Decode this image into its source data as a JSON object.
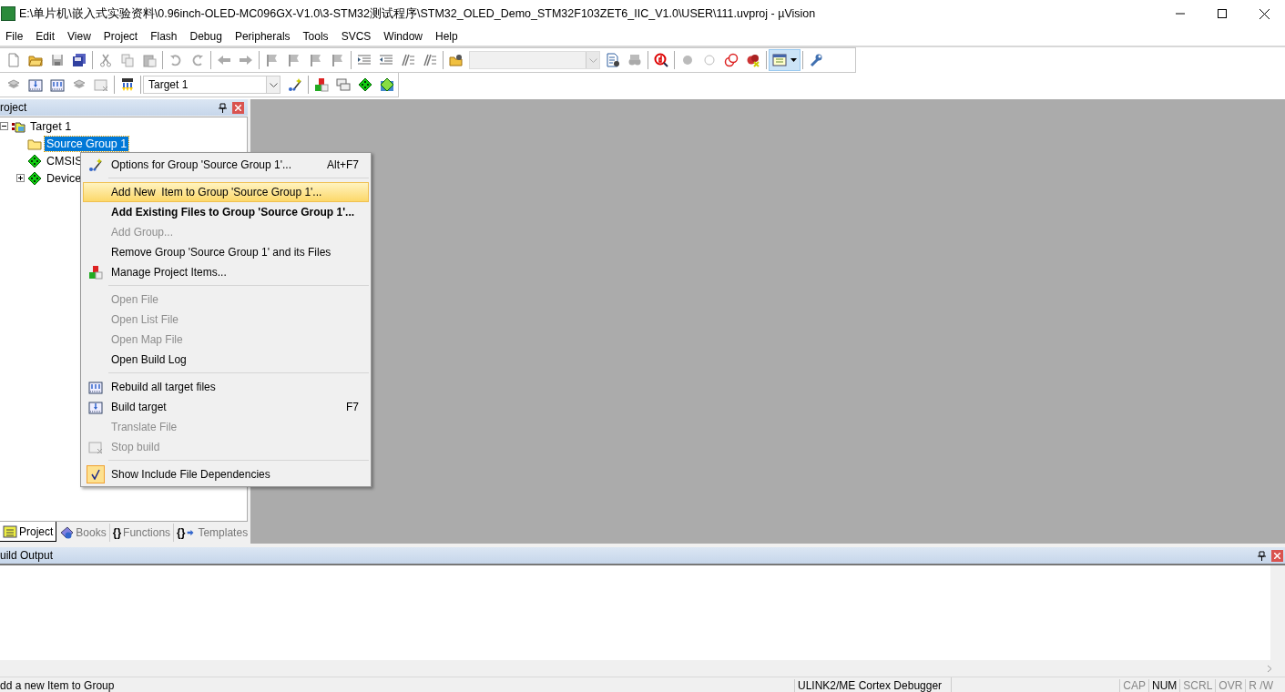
{
  "window": {
    "title": "E:\\单片机\\嵌入式实验资料\\0.96inch-OLED-MC096GX-V1.0\\3-STM32测试程序\\STM32_OLED_Demo_STM32F103ZET6_IIC_V1.0\\USER\\111.uvproj - µVision"
  },
  "menu_bar": [
    "File",
    "Edit",
    "View",
    "Project",
    "Flash",
    "Debug",
    "Peripherals",
    "Tools",
    "SVCS",
    "Window",
    "Help"
  ],
  "toolbar_2": {
    "target": "Target 1"
  },
  "project_panel": {
    "title": "roject",
    "tree": [
      {
        "label": "Target 1",
        "selected": false,
        "expanded": true,
        "children": [
          {
            "label": "Source Group 1",
            "selected": true
          },
          {
            "label": "CMSIS",
            "selected": false
          },
          {
            "label": "Device",
            "selected": false,
            "expanded": false
          }
        ]
      }
    ],
    "tabs": [
      {
        "label": "Project",
        "selected": true
      },
      {
        "label": "Books",
        "selected": false
      },
      {
        "label": "Functions",
        "glyph": "{}",
        "selected": false
      },
      {
        "label": "Templates",
        "glyph": "{}",
        "selected": false
      }
    ]
  },
  "context_menu": {
    "items": [
      {
        "kind": "item",
        "label": "Options for Group 'Source Group 1'...",
        "shortcut": "Alt+F7",
        "disabled": false,
        "bold": false,
        "selected": false,
        "checked": false
      },
      {
        "kind": "separator"
      },
      {
        "kind": "item",
        "label": "Add New  Item to Group 'Source Group 1'...",
        "disabled": false,
        "bold": false,
        "selected": true,
        "checked": false
      },
      {
        "kind": "item",
        "label": "Add Existing Files to Group 'Source Group 1'...",
        "disabled": false,
        "bold": true,
        "selected": false,
        "checked": false
      },
      {
        "kind": "item",
        "label": "Add Group...",
        "disabled": true,
        "bold": false,
        "selected": false,
        "checked": false
      },
      {
        "kind": "item",
        "label": "Remove Group 'Source Group 1' and its Files",
        "disabled": false,
        "bold": false,
        "selected": false,
        "checked": false
      },
      {
        "kind": "item",
        "label": "Manage Project Items...",
        "disabled": false,
        "bold": false,
        "selected": false,
        "checked": false
      },
      {
        "kind": "separator"
      },
      {
        "kind": "item",
        "label": "Open File",
        "disabled": true,
        "bold": false,
        "selected": false,
        "checked": false
      },
      {
        "kind": "item",
        "label": "Open List File",
        "disabled": true,
        "bold": false,
        "selected": false,
        "checked": false
      },
      {
        "kind": "item",
        "label": "Open Map File",
        "disabled": true,
        "bold": false,
        "selected": false,
        "checked": false
      },
      {
        "kind": "item",
        "label": "Open Build Log",
        "disabled": false,
        "bold": false,
        "selected": false,
        "checked": false
      },
      {
        "kind": "separator"
      },
      {
        "kind": "item",
        "label": "Rebuild all target files",
        "disabled": false,
        "bold": false,
        "selected": false,
        "checked": false
      },
      {
        "kind": "item",
        "label": "Build target",
        "shortcut": "F7",
        "disabled": false,
        "bold": false,
        "selected": false,
        "checked": false
      },
      {
        "kind": "item",
        "label": "Translate File",
        "disabled": true,
        "bold": false,
        "selected": false,
        "checked": false
      },
      {
        "kind": "item",
        "label": "Stop build",
        "disabled": true,
        "bold": false,
        "selected": false,
        "checked": false
      },
      {
        "kind": "separator"
      },
      {
        "kind": "item",
        "label": "Show Include File Dependencies",
        "disabled": false,
        "bold": false,
        "selected": false,
        "checked": true
      }
    ]
  },
  "build_output": {
    "title": "uild Output"
  },
  "status_bar": {
    "message": "dd a new Item to Group",
    "debugger": "ULINK2/ME Cortex Debugger",
    "indicators": [
      {
        "label": "CAP",
        "on": false
      },
      {
        "label": "NUM",
        "on": true
      },
      {
        "label": "SCRL",
        "on": false
      },
      {
        "label": "OVR",
        "on": false
      },
      {
        "label": "R /W",
        "on": false
      }
    ]
  }
}
